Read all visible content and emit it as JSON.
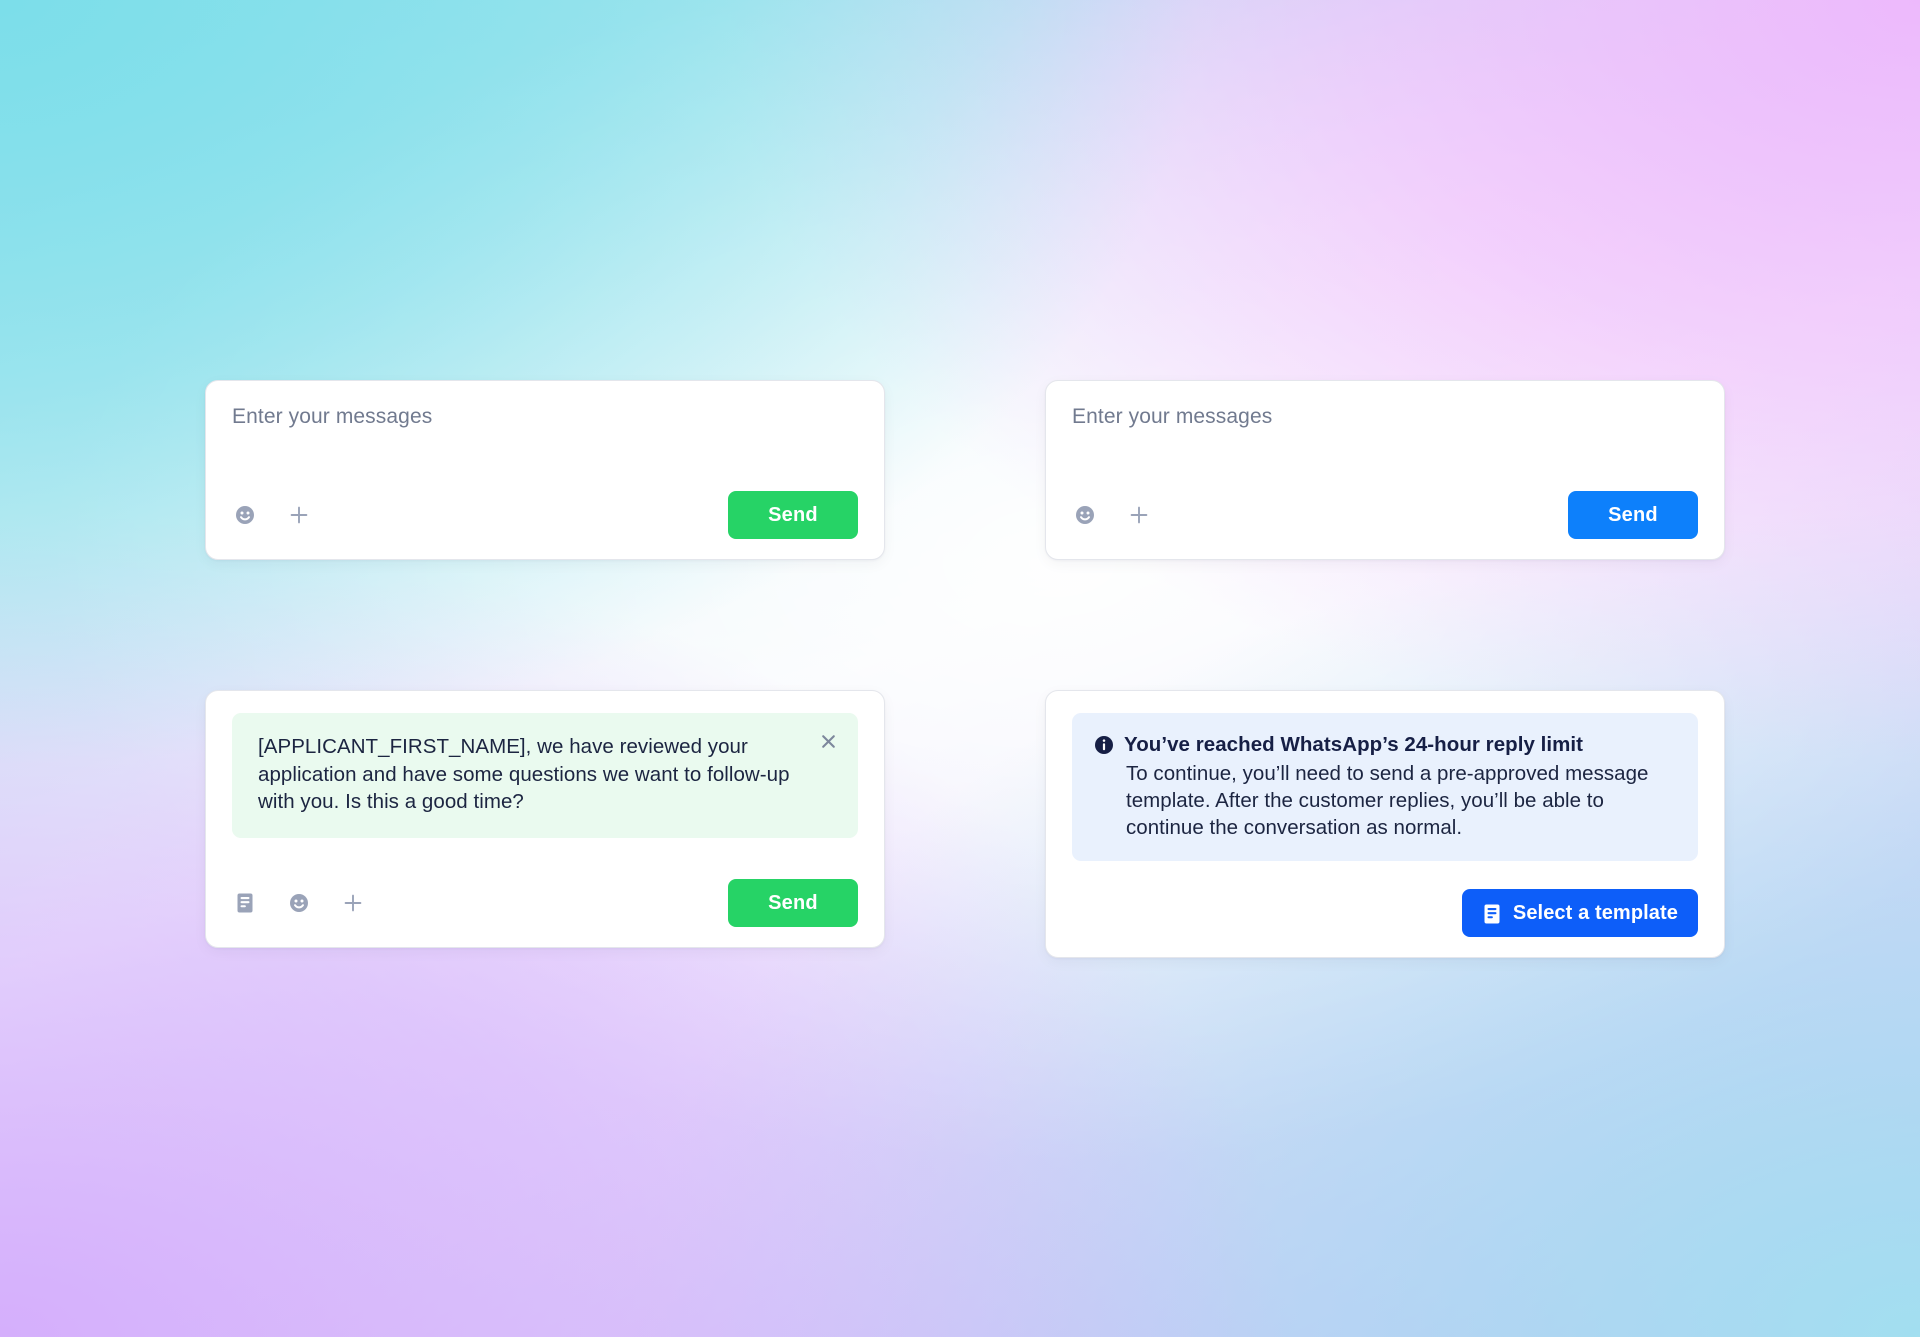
{
  "theme": {
    "accent_green": "#26d366",
    "accent_blue": "#0d80fb",
    "accent_blue_dark": "#0d5ef9",
    "bubble_green_bg": "#eafaef",
    "notice_blue_bg": "#e9f1fd",
    "text_dark": "#1c2541",
    "text_muted": "#717a8f",
    "icon_gray": "#9aa3b8",
    "card_bg": "#ffffff",
    "card_border": "#e4e6ec",
    "background_top_left": "#7adeea",
    "background_top_right": "#eeb6fc",
    "background_bottom_left": "#d4acfc",
    "background_bottom_right": "#a0e1f0"
  },
  "compose_green": {
    "placeholder": "Enter your messages",
    "send_label": "Send",
    "emoji_icon": "emoji-smiley-icon",
    "attach_icon": "plus-icon"
  },
  "compose_blue": {
    "placeholder": "Enter your messages",
    "send_label": "Send",
    "emoji_icon": "emoji-smiley-icon",
    "attach_icon": "plus-icon"
  },
  "template_compose": {
    "message": "[APPLICANT_FIRST_NAME], we have reviewed your application and have some questions we want to follow-up with you. Is this a good time?",
    "close_icon": "close-x-icon",
    "template_icon": "template-document-icon",
    "emoji_icon": "emoji-smiley-icon",
    "attach_icon": "plus-icon",
    "send_label": "Send"
  },
  "reply_limit_notice": {
    "info_icon": "info-circle-icon",
    "title": "You’ve reached WhatsApp’s 24-hour reply limit",
    "body": "To continue, you’ll need to send a pre-approved message template. After the customer replies, you’ll be able to continue the conversation as normal.",
    "action_label": "Select a template",
    "action_icon": "template-document-icon"
  }
}
